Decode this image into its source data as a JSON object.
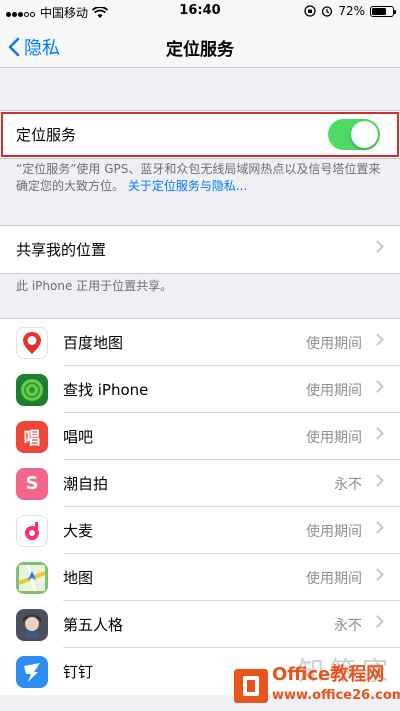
{
  "status_bar": {
    "carrier": "中国移动",
    "time": "16:40",
    "battery": "72%",
    "battery_level": 0.72
  },
  "nav": {
    "back_label": "隐私",
    "title": "定位服务"
  },
  "location_services": {
    "label": "定位服务",
    "enabled": true,
    "footnote": "“定位服务”使用 GPS、蓝牙和众包无线局域网热点以及信号塔位置来确定您的大致方位。",
    "footnote_link": "关于定位服务与隐私..."
  },
  "share_location": {
    "label": "共享我的位置",
    "footnote": "此 iPhone 正用于位置共享。"
  },
  "apps": [
    {
      "name": "百度地图",
      "value": "使用期间",
      "icon": "baidu-map-icon",
      "color": "#ffffff"
    },
    {
      "name": "查找 iPhone",
      "value": "使用期间",
      "icon": "find-iphone-icon",
      "color": "#1e7d33"
    },
    {
      "name": "唱吧",
      "value": "使用期间",
      "icon": "changba-icon",
      "color": "#f0453a"
    },
    {
      "name": "潮自拍",
      "value": "永不",
      "icon": "chaozipai-icon",
      "color": "#f2668c"
    },
    {
      "name": "大麦",
      "value": "使用期间",
      "icon": "damai-icon",
      "color": "#ffffff"
    },
    {
      "name": "地图",
      "value": "使用期间",
      "icon": "maps-icon",
      "color": "#7bc36b"
    },
    {
      "name": "第五人格",
      "value": "永不",
      "icon": "identity-v-icon",
      "color": "#4a4f5a"
    },
    {
      "name": "钉钉",
      "value": "",
      "icon": "dingtalk-icon",
      "color": "#2d8cf0"
    }
  ],
  "watermark": {
    "text": "知笨家",
    "brand": "Office教程网",
    "url": "www.office26.com"
  }
}
